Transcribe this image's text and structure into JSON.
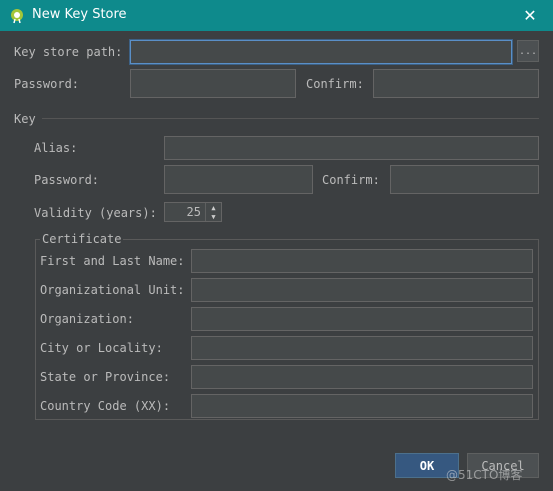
{
  "window": {
    "title": "New Key Store",
    "close_glyph": "✕"
  },
  "keystore": {
    "path_label": "Key store path:",
    "path_value": "",
    "browse_label": "...",
    "password_label": "Password:",
    "password_value": "",
    "confirm_label": "Confirm:",
    "confirm_value": ""
  },
  "key": {
    "section_label": "Key",
    "alias_label": "Alias:",
    "alias_value": "",
    "password_label": "Password:",
    "password_value": "",
    "confirm_label": "Confirm:",
    "confirm_value": "",
    "validity_label": "Validity (years):",
    "validity_value": "25"
  },
  "certificate": {
    "section_label": "Certificate",
    "fields": [
      {
        "label": "First and Last Name:",
        "value": ""
      },
      {
        "label": "Organizational Unit:",
        "value": ""
      },
      {
        "label": "Organization:",
        "value": ""
      },
      {
        "label": "City or Locality:",
        "value": ""
      },
      {
        "label": "State or Province:",
        "value": ""
      },
      {
        "label": "Country Code (XX):",
        "value": ""
      }
    ]
  },
  "buttons": {
    "ok": "OK",
    "cancel": "Cancel"
  },
  "watermark": "@51CTO博客",
  "colors": {
    "titlebar": "#0e8a8c",
    "background": "#3c3f41",
    "field_bg": "#45494a",
    "accent_ok": "#365880",
    "focus_border": "#5a8fc7"
  }
}
